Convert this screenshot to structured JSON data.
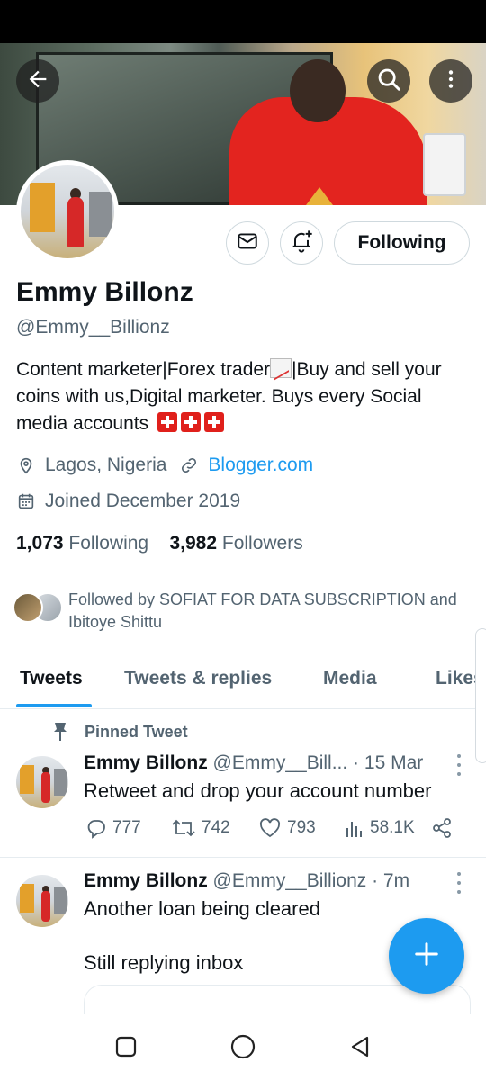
{
  "profile": {
    "display_name": "Emmy Billonz",
    "handle": "@Emmy__Billionz",
    "bio_text": "Content marketer|Forex trader",
    "bio_text_2": "|Buy and sell your coins with us,Digital marketer. Buys every Social media accounts",
    "location": "Lagos, Nigeria",
    "website": "Blogger.com",
    "joined": "Joined December 2019",
    "following_count": "1,073",
    "following_label": "Following",
    "followers_count": "3,982",
    "followers_label": "Followers",
    "followed_by": "Followed by SOFIAT FOR DATA SUBSCRIPTION and Ibitoye Shittu"
  },
  "header": {
    "following_button": "Following"
  },
  "tabs": [
    {
      "label": "Tweets",
      "active": true
    },
    {
      "label": "Tweets & replies",
      "active": false
    },
    {
      "label": "Media",
      "active": false
    },
    {
      "label": "Likes",
      "active": false
    }
  ],
  "tweets": [
    {
      "pinned_label": "Pinned Tweet",
      "name": "Emmy Billonz",
      "meta": "@Emmy__Bill... · 15 Mar",
      "text": "Retweet and drop your account number",
      "replies": "777",
      "retweets": "742",
      "likes": "793",
      "views": "58.1K"
    },
    {
      "name": "Emmy Billonz",
      "meta": "@Emmy__Billionz · 7m",
      "text": "Another loan being cleared",
      "text_2": "Still replying inbox"
    }
  ],
  "colors": {
    "accent": "#1d9bf0",
    "text_primary": "#0f1419",
    "text_secondary": "#536471",
    "border": "#cfd9de"
  },
  "icons": [
    "back-arrow-icon",
    "search-icon",
    "more-vertical-icon",
    "envelope-icon",
    "bell-plus-icon",
    "location-pin-icon",
    "link-icon",
    "calendar-icon",
    "pin-icon",
    "reply-icon",
    "retweet-icon",
    "heart-icon",
    "views-icon",
    "share-icon",
    "plus-icon",
    "square-nav-icon",
    "circle-nav-icon",
    "triangle-back-nav-icon"
  ]
}
